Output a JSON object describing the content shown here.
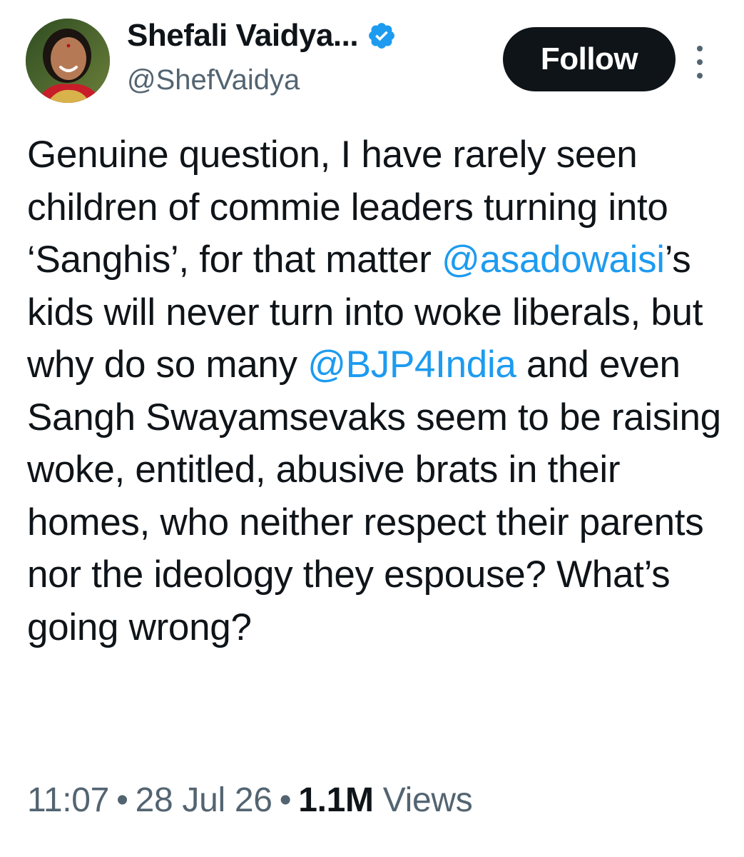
{
  "author": {
    "display_name": "Shefali Vaidya...",
    "handle": "@ShefVaidya",
    "verified": true,
    "avatar_icon": "profile-photo"
  },
  "actions": {
    "follow_label": "Follow",
    "more_icon": "more-vertical-icon"
  },
  "tweet": {
    "segments": [
      {
        "type": "text",
        "text": "Genuine question, I have rarely seen children of commie leaders turning into ‘Sanghis’, for that matter "
      },
      {
        "type": "mention",
        "text": "@asadowaisi"
      },
      {
        "type": "text",
        "text": "’s kids will never turn into woke liberals, but why do so many "
      },
      {
        "type": "mention",
        "text": "@BJP4India"
      },
      {
        "type": "text",
        "text": " and even Sangh Swayamsevaks seem to be raising woke, entitled, abusive brats in their homes, who neither respect their parents nor the ideology they espouse? What’s going wrong?"
      }
    ]
  },
  "meta": {
    "time": "11:07",
    "date": "28 Jul 26",
    "views_count": "1.1M",
    "views_label": "Views",
    "separator": "•"
  },
  "colors": {
    "text": "#0f1419",
    "secondary": "#536471",
    "link": "#1d9bf0",
    "button_bg": "#0f1419",
    "verified": "#1d9bf0"
  }
}
